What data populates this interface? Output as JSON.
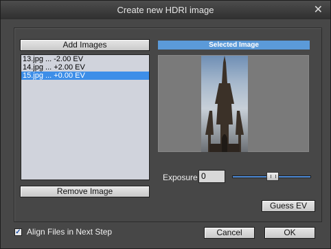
{
  "window": {
    "title": "Create new HDRI image",
    "close_icon": "close-icon"
  },
  "left": {
    "add_images_label": "Add Images",
    "remove_image_label": "Remove Image",
    "files": [
      {
        "label": "13.jpg ... -2.00 EV",
        "selected": false
      },
      {
        "label": "14.jpg ... +2.00 EV",
        "selected": false
      },
      {
        "label": "15.jpg ... +0.00 EV",
        "selected": true
      }
    ]
  },
  "right": {
    "selected_header": "Selected Image",
    "exposure_label": "Exposure",
    "exposure_value": "0",
    "guess_ev_label": "Guess EV",
    "exposure_slider_fraction": 0.5
  },
  "footer": {
    "align_label": "Align Files in Next Step",
    "align_checked": true,
    "cancel_label": "Cancel",
    "ok_label": "OK"
  },
  "colors": {
    "accent": "#3d8ee8",
    "header": "#5b9ad9"
  }
}
